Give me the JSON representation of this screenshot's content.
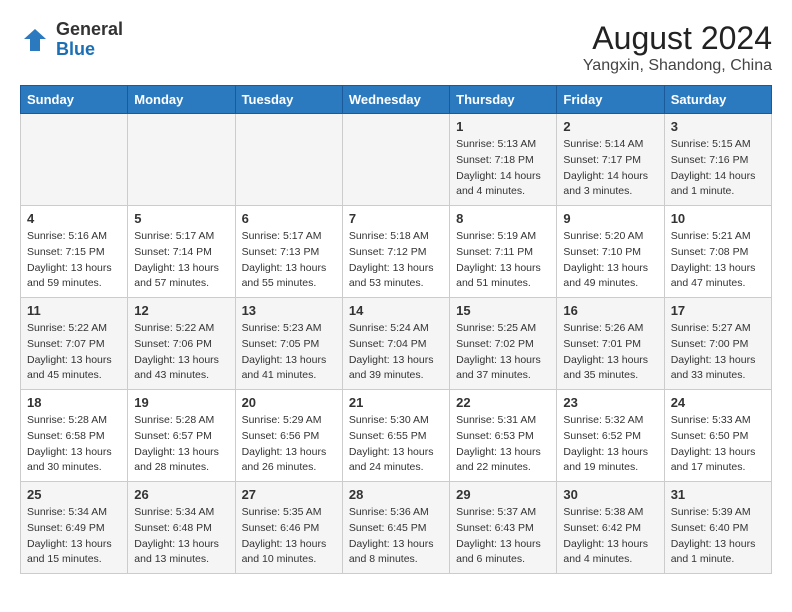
{
  "header": {
    "logo_general": "General",
    "logo_blue": "Blue",
    "month_year": "August 2024",
    "location": "Yangxin, Shandong, China"
  },
  "days_of_week": [
    "Sunday",
    "Monday",
    "Tuesday",
    "Wednesday",
    "Thursday",
    "Friday",
    "Saturday"
  ],
  "weeks": [
    [
      {
        "day": "",
        "info": ""
      },
      {
        "day": "",
        "info": ""
      },
      {
        "day": "",
        "info": ""
      },
      {
        "day": "",
        "info": ""
      },
      {
        "day": "1",
        "info": "Sunrise: 5:13 AM\nSunset: 7:18 PM\nDaylight: 14 hours\nand 4 minutes."
      },
      {
        "day": "2",
        "info": "Sunrise: 5:14 AM\nSunset: 7:17 PM\nDaylight: 14 hours\nand 3 minutes."
      },
      {
        "day": "3",
        "info": "Sunrise: 5:15 AM\nSunset: 7:16 PM\nDaylight: 14 hours\nand 1 minute."
      }
    ],
    [
      {
        "day": "4",
        "info": "Sunrise: 5:16 AM\nSunset: 7:15 PM\nDaylight: 13 hours\nand 59 minutes."
      },
      {
        "day": "5",
        "info": "Sunrise: 5:17 AM\nSunset: 7:14 PM\nDaylight: 13 hours\nand 57 minutes."
      },
      {
        "day": "6",
        "info": "Sunrise: 5:17 AM\nSunset: 7:13 PM\nDaylight: 13 hours\nand 55 minutes."
      },
      {
        "day": "7",
        "info": "Sunrise: 5:18 AM\nSunset: 7:12 PM\nDaylight: 13 hours\nand 53 minutes."
      },
      {
        "day": "8",
        "info": "Sunrise: 5:19 AM\nSunset: 7:11 PM\nDaylight: 13 hours\nand 51 minutes."
      },
      {
        "day": "9",
        "info": "Sunrise: 5:20 AM\nSunset: 7:10 PM\nDaylight: 13 hours\nand 49 minutes."
      },
      {
        "day": "10",
        "info": "Sunrise: 5:21 AM\nSunset: 7:08 PM\nDaylight: 13 hours\nand 47 minutes."
      }
    ],
    [
      {
        "day": "11",
        "info": "Sunrise: 5:22 AM\nSunset: 7:07 PM\nDaylight: 13 hours\nand 45 minutes."
      },
      {
        "day": "12",
        "info": "Sunrise: 5:22 AM\nSunset: 7:06 PM\nDaylight: 13 hours\nand 43 minutes."
      },
      {
        "day": "13",
        "info": "Sunrise: 5:23 AM\nSunset: 7:05 PM\nDaylight: 13 hours\nand 41 minutes."
      },
      {
        "day": "14",
        "info": "Sunrise: 5:24 AM\nSunset: 7:04 PM\nDaylight: 13 hours\nand 39 minutes."
      },
      {
        "day": "15",
        "info": "Sunrise: 5:25 AM\nSunset: 7:02 PM\nDaylight: 13 hours\nand 37 minutes."
      },
      {
        "day": "16",
        "info": "Sunrise: 5:26 AM\nSunset: 7:01 PM\nDaylight: 13 hours\nand 35 minutes."
      },
      {
        "day": "17",
        "info": "Sunrise: 5:27 AM\nSunset: 7:00 PM\nDaylight: 13 hours\nand 33 minutes."
      }
    ],
    [
      {
        "day": "18",
        "info": "Sunrise: 5:28 AM\nSunset: 6:58 PM\nDaylight: 13 hours\nand 30 minutes."
      },
      {
        "day": "19",
        "info": "Sunrise: 5:28 AM\nSunset: 6:57 PM\nDaylight: 13 hours\nand 28 minutes."
      },
      {
        "day": "20",
        "info": "Sunrise: 5:29 AM\nSunset: 6:56 PM\nDaylight: 13 hours\nand 26 minutes."
      },
      {
        "day": "21",
        "info": "Sunrise: 5:30 AM\nSunset: 6:55 PM\nDaylight: 13 hours\nand 24 minutes."
      },
      {
        "day": "22",
        "info": "Sunrise: 5:31 AM\nSunset: 6:53 PM\nDaylight: 13 hours\nand 22 minutes."
      },
      {
        "day": "23",
        "info": "Sunrise: 5:32 AM\nSunset: 6:52 PM\nDaylight: 13 hours\nand 19 minutes."
      },
      {
        "day": "24",
        "info": "Sunrise: 5:33 AM\nSunset: 6:50 PM\nDaylight: 13 hours\nand 17 minutes."
      }
    ],
    [
      {
        "day": "25",
        "info": "Sunrise: 5:34 AM\nSunset: 6:49 PM\nDaylight: 13 hours\nand 15 minutes."
      },
      {
        "day": "26",
        "info": "Sunrise: 5:34 AM\nSunset: 6:48 PM\nDaylight: 13 hours\nand 13 minutes."
      },
      {
        "day": "27",
        "info": "Sunrise: 5:35 AM\nSunset: 6:46 PM\nDaylight: 13 hours\nand 10 minutes."
      },
      {
        "day": "28",
        "info": "Sunrise: 5:36 AM\nSunset: 6:45 PM\nDaylight: 13 hours\nand 8 minutes."
      },
      {
        "day": "29",
        "info": "Sunrise: 5:37 AM\nSunset: 6:43 PM\nDaylight: 13 hours\nand 6 minutes."
      },
      {
        "day": "30",
        "info": "Sunrise: 5:38 AM\nSunset: 6:42 PM\nDaylight: 13 hours\nand 4 minutes."
      },
      {
        "day": "31",
        "info": "Sunrise: 5:39 AM\nSunset: 6:40 PM\nDaylight: 13 hours\nand 1 minute."
      }
    ]
  ]
}
